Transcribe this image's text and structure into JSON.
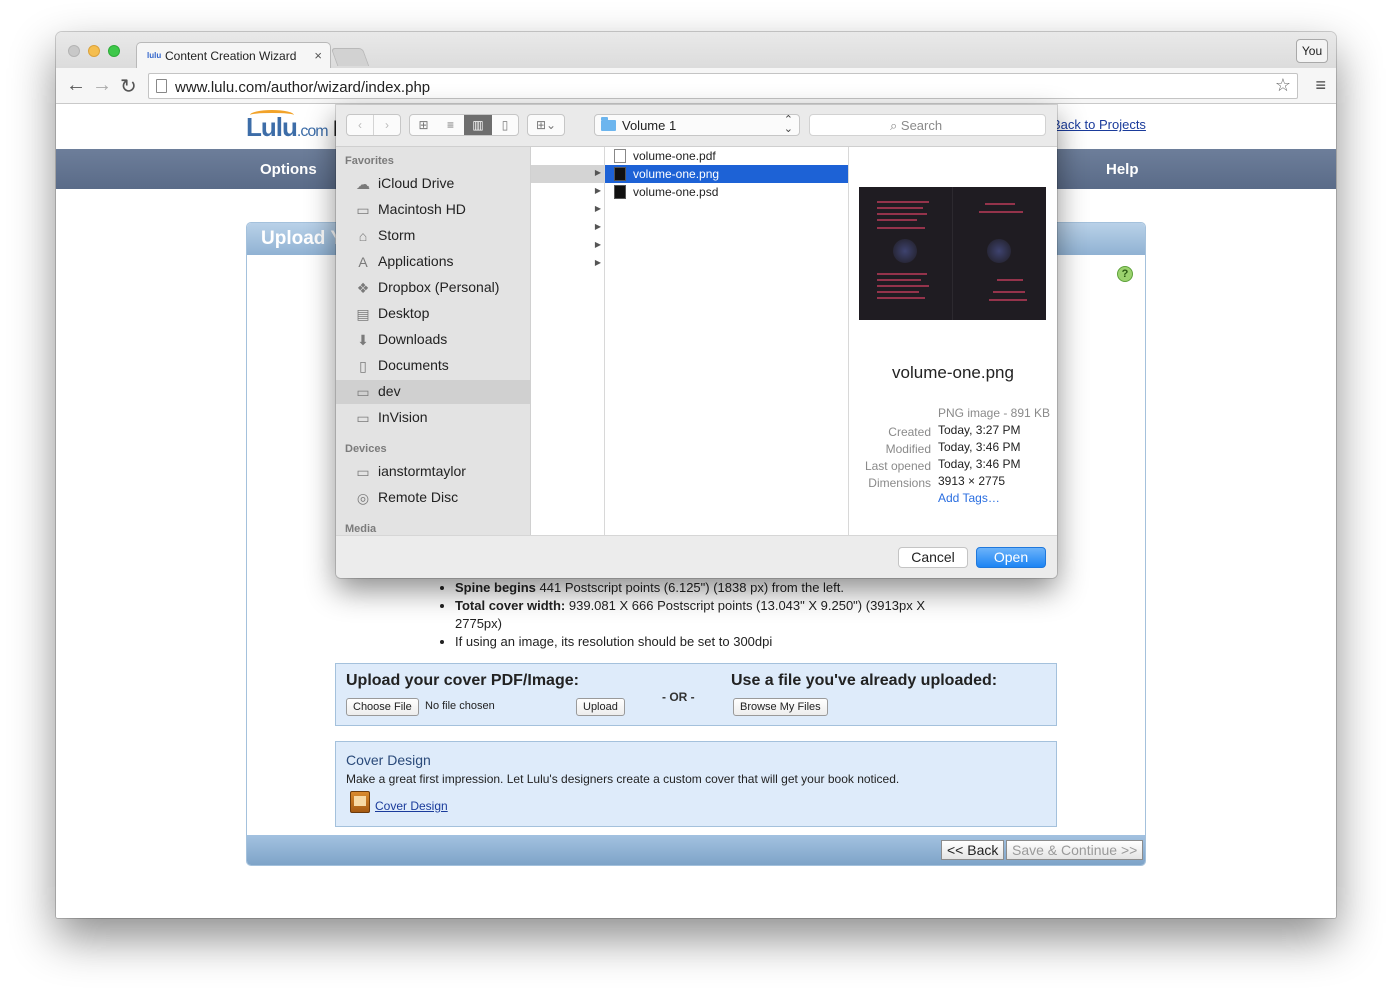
{
  "browser": {
    "tab_title": "Content Creation Wizard",
    "tab_favicon": "lulu",
    "tab_close": "×",
    "profile": "You",
    "url": "www.lulu.com/author/wizard/index.php",
    "back_icon": "←",
    "forward_icon": "→",
    "reload_icon": "↻",
    "star_icon": "☆",
    "menu_icon": "≡"
  },
  "site": {
    "logo_main": "Lulu",
    "logo_suffix": ".com",
    "header_title": "E",
    "back_to_projects": "Back to Projects",
    "nav": {
      "options": "Options",
      "help": "Help"
    }
  },
  "panel": {
    "title": "Upload Yo",
    "help_icon": "?",
    "bullets": [
      {
        "bold": "Spine begins",
        "text": " 441 Postscript points (6.125\") (1838 px) from the left."
      },
      {
        "bold": "Total cover width:",
        "text": " 939.081 X 666 Postscript points (13.043\" X 9.250\") (3913px X 2775px)"
      },
      {
        "bold": "",
        "text": "If using an image, its resolution should be set to 300dpi"
      }
    ],
    "upload": {
      "heading": "Upload your cover PDF/Image:",
      "choose_file": "Choose File",
      "no_file": "No file chosen",
      "upload_btn": "Upload",
      "or": "- OR -",
      "use_heading": "Use a file you've already uploaded:",
      "browse_btn": "Browse My Files"
    },
    "design": {
      "heading": "Cover Design",
      "text": "Make a great first impression. Let Lulu's designers create a custom cover that will get your book noticed.",
      "link": "Cover Design"
    },
    "footer": {
      "back": "<< Back",
      "save": "Save & Continue >>"
    }
  },
  "dialog": {
    "location": "Volume 1",
    "search_placeholder": "Search",
    "favorites_header": "Favorites",
    "favorites": [
      {
        "label": "iCloud Drive",
        "icon": "☁"
      },
      {
        "label": "Macintosh HD",
        "icon": "▭"
      },
      {
        "label": "Storm",
        "icon": "⌂"
      },
      {
        "label": "Applications",
        "icon": "A"
      },
      {
        "label": "Dropbox (Personal)",
        "icon": "❖"
      },
      {
        "label": "Desktop",
        "icon": "▤"
      },
      {
        "label": "Downloads",
        "icon": "⬇"
      },
      {
        "label": "Documents",
        "icon": "▯"
      },
      {
        "label": "dev",
        "icon": "▭"
      },
      {
        "label": "InVision",
        "icon": "▭"
      }
    ],
    "devices_header": "Devices",
    "devices": [
      {
        "label": "ianstormtaylor",
        "icon": "▭"
      },
      {
        "label": "Remote Disc",
        "icon": "◎"
      }
    ],
    "media_header": "Media",
    "files": [
      {
        "name": "volume-one.pdf"
      },
      {
        "name": "volume-one.png"
      },
      {
        "name": "volume-one.psd"
      }
    ],
    "preview": {
      "name": "volume-one.png",
      "type": "PNG image - 891 KB",
      "created_label": "Created",
      "created": "Today, 3:27 PM",
      "modified_label": "Modified",
      "modified": "Today, 3:46 PM",
      "opened_label": "Last opened",
      "opened": "Today, 3:46 PM",
      "dims_label": "Dimensions",
      "dims": "3913 × 2775",
      "add_tags": "Add Tags…"
    },
    "cancel": "Cancel",
    "open": "Open"
  }
}
